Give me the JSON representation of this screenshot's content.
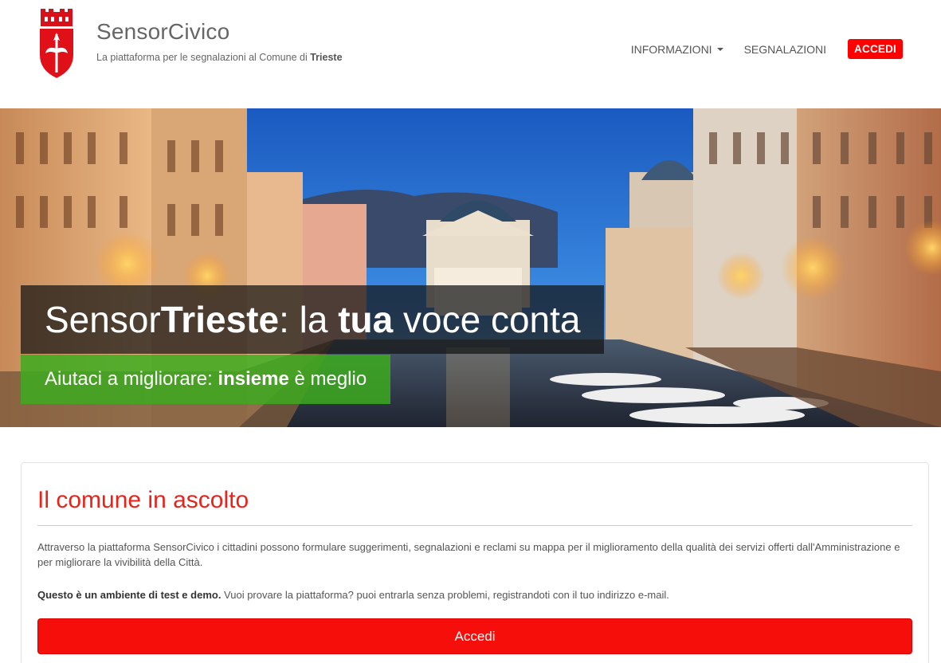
{
  "brand": {
    "title": "SensorCivico",
    "subtitle_prefix": "La piattaforma per le segnalazioni al Comune di",
    "subtitle_city": "Trieste"
  },
  "nav": {
    "informazioni": "INFORMAZIONI",
    "segnalazioni": "SEGNALAZIONI",
    "accedi": "ACCEDI"
  },
  "hero": {
    "title_part1": "Sensor",
    "title_bold": "Trieste",
    "title_part2": ": la ",
    "title_bold2": "tua",
    "title_part3": " voce conta",
    "sub_part1": "Aiutaci a migliorare: ",
    "sub_bold": "insieme",
    "sub_part2": " è meglio"
  },
  "panel": {
    "title": "Il comune in ascolto",
    "description": "Attraverso la piattaforma SensorCivico i cittadini possono formulare suggerimenti, segnalazioni e reclami su mappa per il miglioramento della qualità dei servizi offerti dall'Amministrazione e per migliorare la vivibilità della Città.",
    "test_bold": "Questo è un ambiente di test e demo.",
    "test_text": " Vuoi provare la piattaforma? puoi entrarla senza problemi, registrandoti con il tuo indirizzo e-mail.",
    "button": "Accedi"
  },
  "colors": {
    "accent_red": "#ff0000",
    "hero_green": "#3caa1e"
  },
  "icons": {
    "logo": "trieste-coat-of-arms-icon",
    "dropdown": "caret-down-icon"
  }
}
